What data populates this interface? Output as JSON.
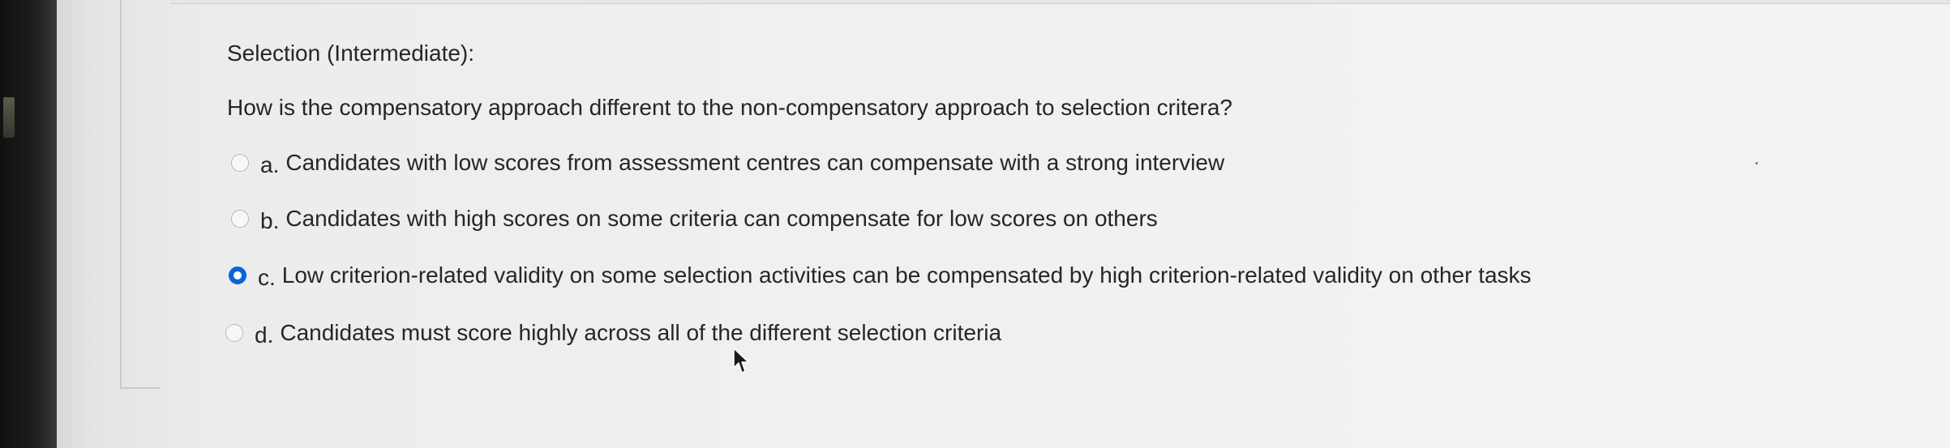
{
  "question": {
    "title": "Selection (Intermediate):",
    "text": "How is the compensatory approach different to the non-compensatory approach to selection critera?",
    "options": [
      {
        "letter": "a.",
        "label": "Candidates with low scores from assessment centres can compensate with a strong interview",
        "selected": false
      },
      {
        "letter": "b.",
        "label": "Candidates with high scores on some criteria can compensate for low scores on others",
        "selected": false
      },
      {
        "letter": "c.",
        "label": "Low criterion-related validity on some selection activities can be compensated by high criterion-related validity on other tasks",
        "selected": true
      },
      {
        "letter": "d.",
        "label": "Candidates must score highly across all of the different selection criteria",
        "selected": false
      }
    ]
  },
  "colors": {
    "accent": "#0a64d6",
    "text": "#262626"
  },
  "icons": {
    "cursor": "mouse-pointer-icon"
  }
}
